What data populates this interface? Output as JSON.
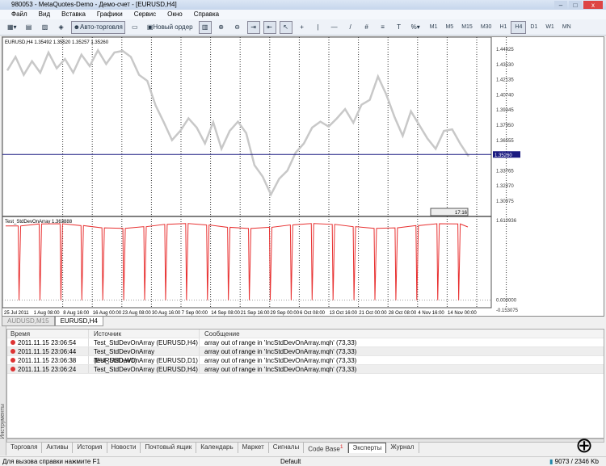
{
  "window": {
    "title": "980053 - MetaQuotes-Demo - Демо-счет - [EURUSD,H4]"
  },
  "menu": [
    "Файл",
    "Вид",
    "Вставка",
    "Графики",
    "Сервис",
    "Окно",
    "Справка"
  ],
  "toolbar": {
    "auto_trading": "Авто-торговля",
    "new_order": "Новый ордер",
    "timeframes": [
      "M1",
      "M5",
      "M15",
      "M30",
      "H1",
      "H4",
      "D1",
      "W1",
      "MN"
    ],
    "active_timeframe": "H4"
  },
  "chart_data": {
    "type": "line",
    "symbol_label": "EURUSD,H4  1.35492 1.35520 1.35257 1.35260",
    "price_ticks": [
      "1.44925",
      "1.43530",
      "1.42135",
      "1.40740",
      "1.39345",
      "1.37950",
      "1.36555",
      "1.35260",
      "1.33765",
      "1.32370",
      "1.30975"
    ],
    "current_price": "1.35260",
    "price_range": [
      1.30975,
      1.44925
    ],
    "price_series": [
      1.432,
      1.44,
      1.428,
      1.436,
      1.43,
      1.444,
      1.434,
      1.438,
      1.43,
      1.442,
      1.436,
      1.446,
      1.438,
      1.444,
      1.45,
      1.44,
      1.428,
      1.418,
      1.4,
      1.38,
      1.368,
      1.372,
      1.388,
      1.375,
      1.365,
      1.38,
      1.36,
      1.372,
      1.385,
      1.37,
      1.345,
      1.33,
      1.318,
      1.328,
      1.34,
      1.352,
      1.365,
      1.375,
      1.385,
      1.376,
      1.388,
      1.392,
      1.384,
      1.396,
      1.405,
      1.422,
      1.41,
      1.385,
      1.372,
      1.39,
      1.382,
      1.365,
      1.36,
      1.372,
      1.378,
      1.36,
      1.353
    ],
    "indicator_label": "Test_StdDevOnArray 1.363888",
    "indicator_ticks": [
      "1.610936",
      "0.000000",
      "-0.153075"
    ],
    "indicator_range": [
      -0.153075,
      1.610936
    ],
    "indicator_level": 1.5,
    "indicator_spikes": 22,
    "time_ticks": [
      "25 Jul 2011",
      "1 Aug 08:00",
      "8 Aug 16:00",
      "16 Aug 00:00",
      "23 Aug 08:00",
      "30 Aug 16:00",
      "7 Sep 00:00",
      "14 Sep 08:00",
      "21 Sep 16:00",
      "29 Sep 00:00",
      "6 Oct 08:00",
      "13 Oct 16:00",
      "21 Oct 00:00",
      "28 Oct 08:00",
      "4 Nov 16:00",
      "14 Nov 00:00"
    ],
    "trade_time": "17:16",
    "colors": {
      "price": "#c8c8c8",
      "indicator": "#e83030",
      "bid_line": "#1a1a80"
    }
  },
  "chart_tabs": [
    "AUDUSD,M15",
    "EURUSD,H4"
  ],
  "log": {
    "headers": [
      "Время",
      "Источник",
      "Сообщение"
    ],
    "rows": [
      [
        "2011.11.15 23:06:54",
        "Test_StdDevOnArray (EURUSD,H4)",
        "array out of range in 'IncStdDevOnArray.mqh' (73,33)"
      ],
      [
        "2011.11.15 23:06:44",
        "Test_StdDevOnArray (EURUSD,W1)",
        "array out of range in 'IncStdDevOnArray.mqh' (73,33)"
      ],
      [
        "2011.11.15 23:06:38",
        "Test_StdDevOnArray (EURUSD,D1)",
        "array out of range in 'IncStdDevOnArray.mqh' (73,33)"
      ],
      [
        "2011.11.15 23:06:24",
        "Test_StdDevOnArray (EURUSD,H4)",
        "array out of range in 'IncStdDevOnArray.mqh' (73,33)"
      ]
    ]
  },
  "side_label": "Инструменты",
  "bottom_tabs": [
    "Торговля",
    "Активы",
    "История",
    "Новости",
    "Почтовый ящик",
    "Календарь",
    "Маркет",
    "Сигналы",
    "Code Base",
    "Эксперты",
    "Журнал"
  ],
  "active_bottom_tab": "Эксперты",
  "codebase_badge": "1",
  "status": {
    "help": "Для вызова справки нажмите F1",
    "profile": "Default",
    "traffic": "9073 / 2346 Kb"
  }
}
